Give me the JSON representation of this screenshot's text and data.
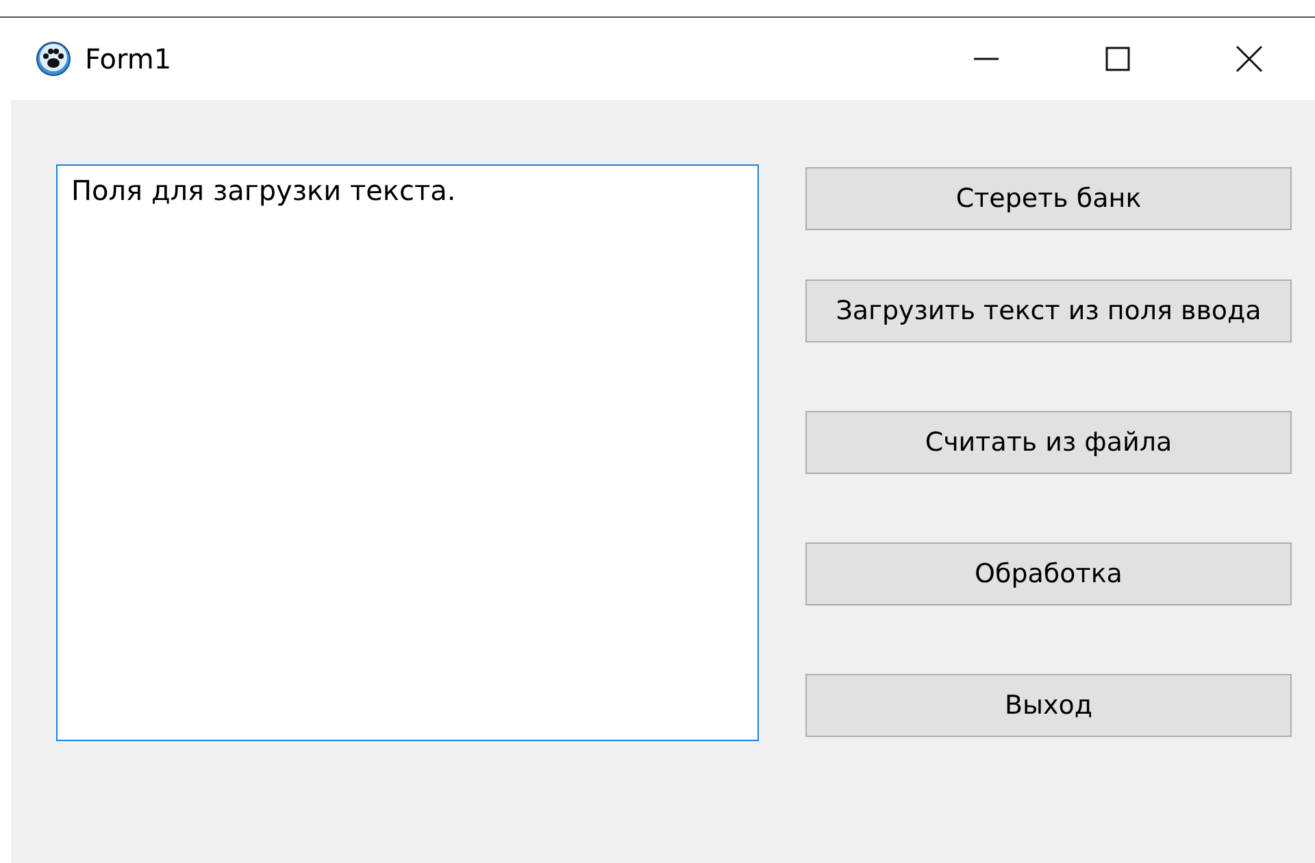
{
  "window": {
    "title": "Form1"
  },
  "text_box": {
    "value": "Поля для загрузки текста.",
    "focused": true
  },
  "buttons": [
    {
      "label": "Стереть банк"
    },
    {
      "label": "Загрузить текст из поля ввода"
    },
    {
      "label": "Считать из файла"
    },
    {
      "label": "Обработка"
    },
    {
      "label": "Выход"
    }
  ]
}
